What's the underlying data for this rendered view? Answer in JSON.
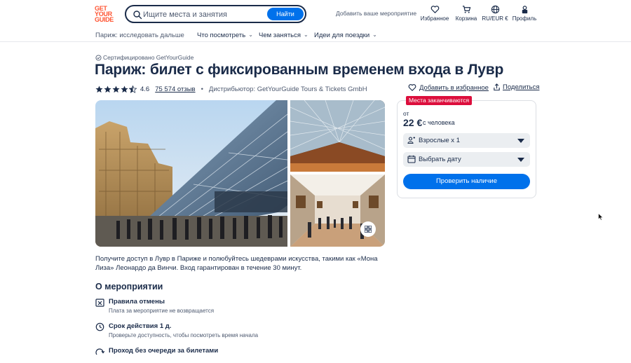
{
  "header": {
    "logo": [
      "GET",
      "YOUR",
      "GUIDE"
    ],
    "search": {
      "placeholder": "Ищите места и занятия",
      "button_label": "Найти"
    },
    "add_activity": "Добавить ваше мероприятие",
    "favorites": "Избранное",
    "cart": "Корзина",
    "language": "RU/EUR €",
    "profile": "Профиль"
  },
  "subnav": {
    "breadcrumb": "Париж: исследовать дальше",
    "items": [
      "Что посмотреть",
      "Чем заняться",
      "Идеи для поездки"
    ]
  },
  "product": {
    "certified": "Сертифицировано GetYourGuide",
    "title": "Париж: билет с фиксированным временем входа в Лувр",
    "rating": "4.6",
    "stars": 4.6,
    "reviews": "75 574 отзыв",
    "distributor": "Дистрибьютор: GetYourGuide Tours & Tickets GmbH",
    "wishlist_label": "Добавить в избранное",
    "share_label": "Поделиться",
    "description": "Получите доступ в Лувр в Париже и полюбуйтесь шедеврами искусства, такими как «Мона Лиза» Леонардо да Винчи. Вход гарантирован в течение 30 минут."
  },
  "about": {
    "heading": "О мероприятии",
    "features": [
      {
        "title": "Правила отмены",
        "subtitle": "Плата за мероприятие не возвращается",
        "icon": "cancel-icon"
      },
      {
        "title": "Срок действия 1 д.",
        "subtitle": "Проверьте доступность, чтобы посмотреть время начала",
        "icon": "clock-icon"
      },
      {
        "title": "Проход без очереди за билетами",
        "subtitle": "",
        "icon": "skip-line-icon"
      }
    ]
  },
  "booking": {
    "badge": "Места заканчиваются",
    "from_label": "от",
    "price": "22 €",
    "per": "с человека",
    "participants": "Взрослые x 1",
    "date": "Выбрать дату",
    "check_button": "Проверить наличие"
  },
  "colors": {
    "brand": "#ff5533",
    "primary": "#0071eb",
    "text": "#1a2b49",
    "badge": "#dc0e3c"
  }
}
